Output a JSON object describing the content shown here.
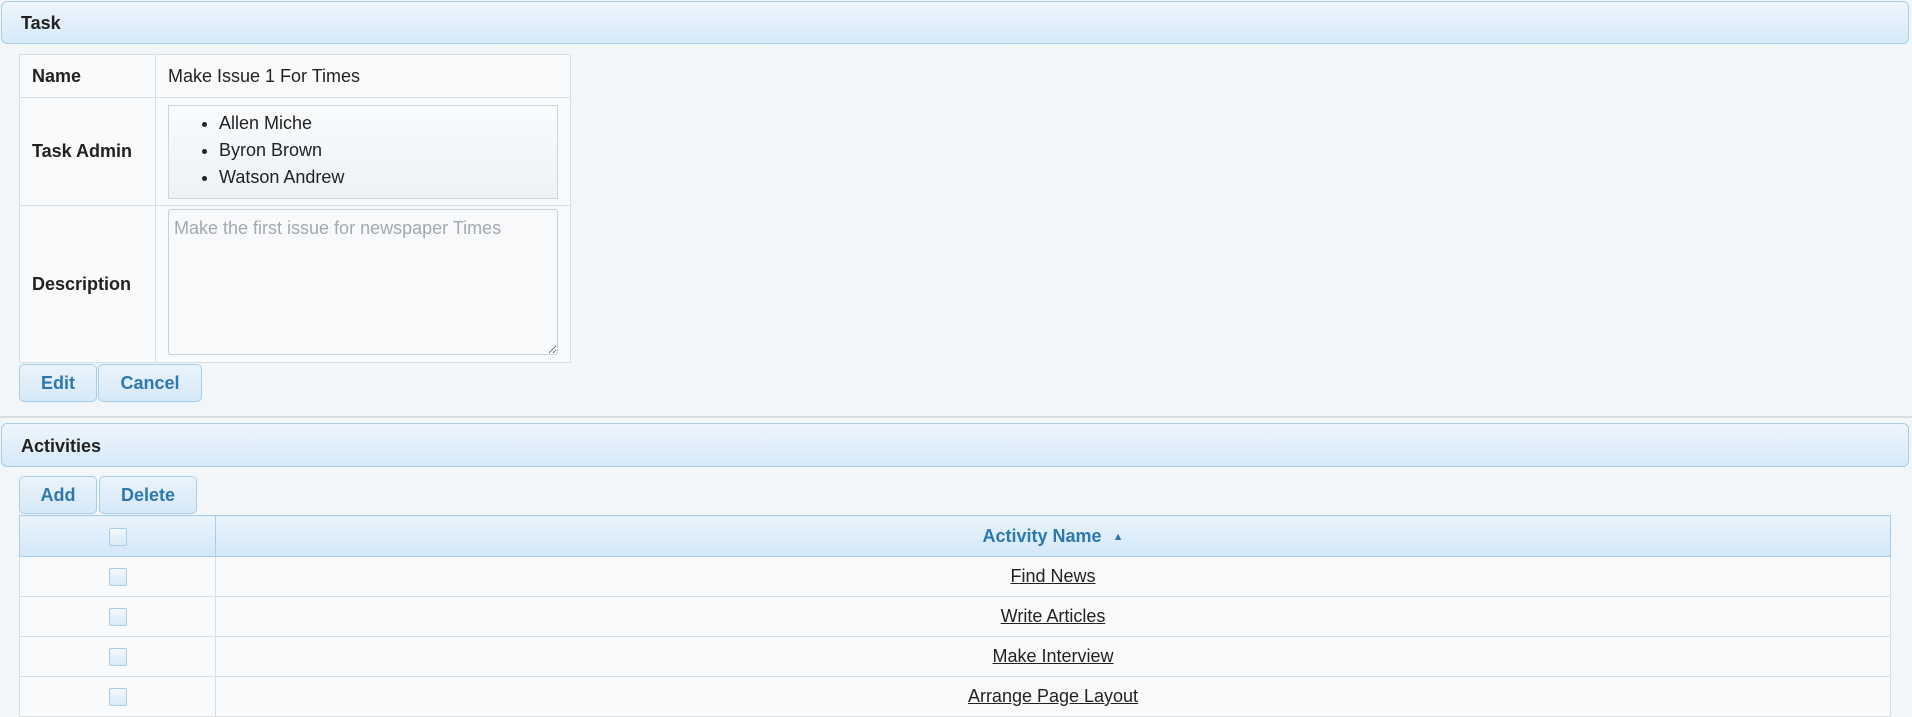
{
  "task_panel": {
    "title": "Task",
    "fields": {
      "name_label": "Name",
      "name_value": "Make Issue 1 For Times",
      "admin_label": "Task Admin",
      "admins": [
        "Allen Miche",
        "Byron Brown",
        "Watson Andrew"
      ],
      "description_label": "Description",
      "description_placeholder": "Make the first issue for newspaper Times"
    },
    "buttons": {
      "edit": "Edit",
      "cancel": "Cancel"
    }
  },
  "activities_panel": {
    "title": "Activities",
    "buttons": {
      "add": "Add",
      "delete": "Delete"
    },
    "table": {
      "column_header": "Activity Name",
      "rows": [
        "Find News",
        "Write Articles",
        "Make Interview",
        "Arrange Page Layout"
      ]
    }
  },
  "icons": {
    "sort": "sort-icon"
  },
  "colors": {
    "accent": "#2e78b0",
    "header_border": "#a8cde9",
    "background": "#f3f6f9"
  }
}
